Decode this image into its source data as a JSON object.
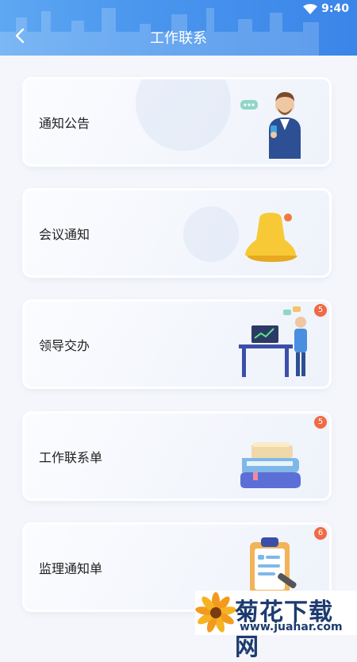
{
  "status_bar": {
    "time": "9:40"
  },
  "header": {
    "title": "工作联系"
  },
  "menu": [
    {
      "label": "通知公告",
      "badge": ""
    },
    {
      "label": "会议通知",
      "badge": ""
    },
    {
      "label": "领导交办",
      "badge": "5"
    },
    {
      "label": "工作联系单",
      "badge": "5"
    },
    {
      "label": "监理通知单",
      "badge": "6"
    }
  ],
  "watermark": {
    "text": "菊花下载网",
    "url": "www.juahar.com"
  },
  "colors": {
    "header": "#4a96ee",
    "badge": "#ef6a45",
    "background": "#f4f6fb"
  }
}
